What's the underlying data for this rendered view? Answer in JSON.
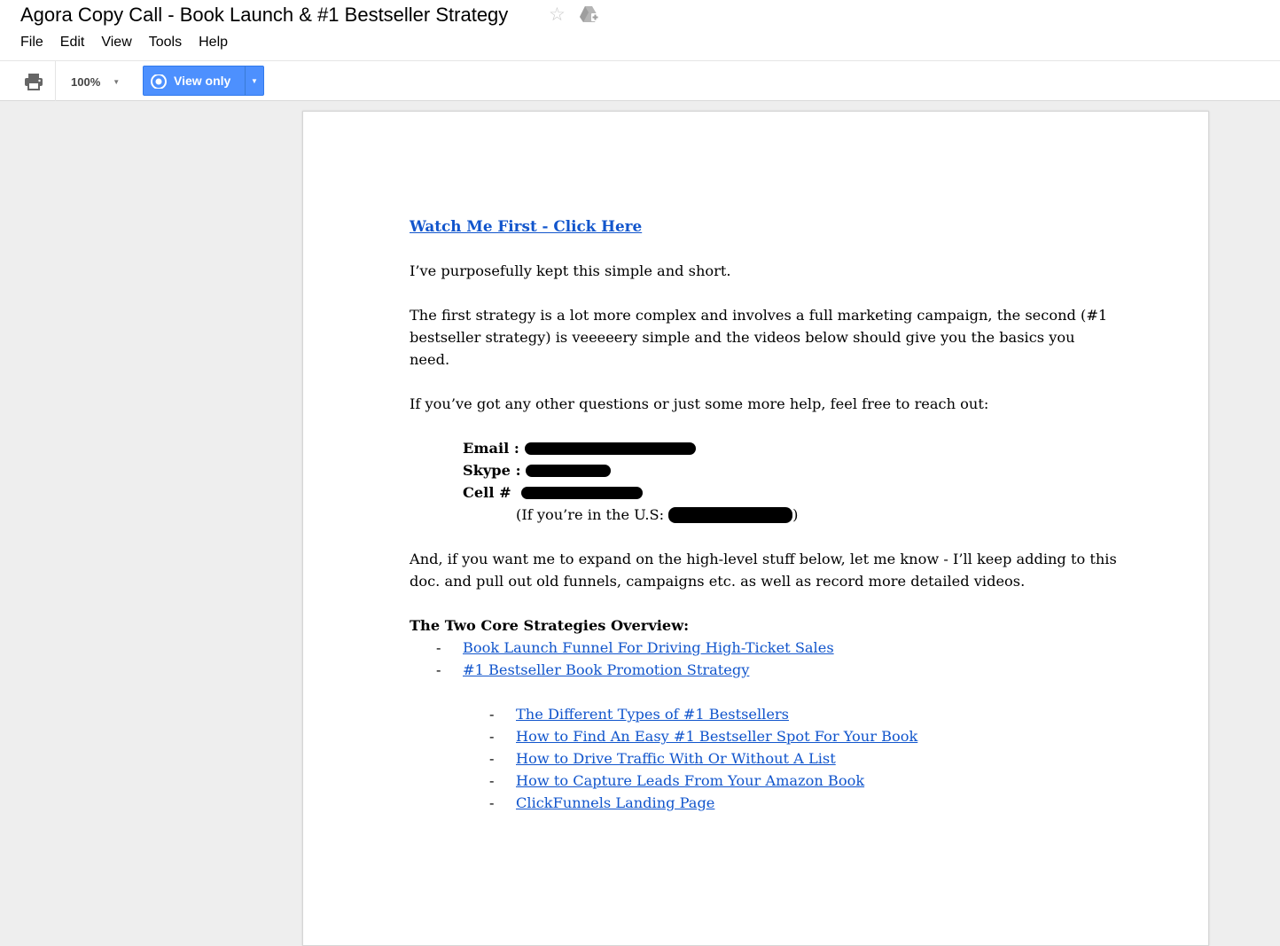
{
  "window": {
    "title": "Agora Copy Call - Book Launch & #1 Bestseller Strategy",
    "star_icon": "star-icon",
    "drive_icon": "drive-icon"
  },
  "menu": {
    "items": [
      "File",
      "Edit",
      "View",
      "Tools",
      "Help"
    ]
  },
  "toolbar": {
    "print_icon": "printer-icon",
    "zoom": "100%",
    "view_only_label": "View only",
    "view_only_icon": "eye-icon",
    "accent_color": "#4d90fe"
  },
  "document": {
    "watch_link": "Watch Me First - Click Here",
    "para1": "I’ve purposefully kept this simple and short.",
    "para2": "The first strategy is a lot more complex and involves a full marketing campaign, the second (#1 bestseller strategy) is veeeeery simple and the videos below should give you the basics you need.",
    "para3": "If you’ve got any other questions or just some more help, feel free to reach out:",
    "contact": {
      "email_label": "Email : ",
      "skype_label": "Skype : ",
      "cell_label": "Cell #  ",
      "us_label": "(If you’re in the U.S: ",
      "us_close": ")"
    },
    "para4": "And, if you want me to expand on the high-level stuff below, let me know - I’ll keep adding to this doc. and pull out old funnels, campaigns etc. as well as record more detailed videos.",
    "overview_heading": "The Two Core Strategies Overview:",
    "dash": "-",
    "strategies": [
      "Book Launch Funnel For Driving High-Ticket Sales",
      "#1 Bestseller Book Promotion Strategy"
    ],
    "videos": [
      "The Different Types of #1 Bestsellers",
      "How to Find An Easy #1 Bestseller Spot For Your Book",
      "How to Drive Traffic With Or Without A List",
      "How to Capture Leads From Your Amazon Book",
      "ClickFunnels Landing Page"
    ],
    "link_color": "#1155cc"
  }
}
